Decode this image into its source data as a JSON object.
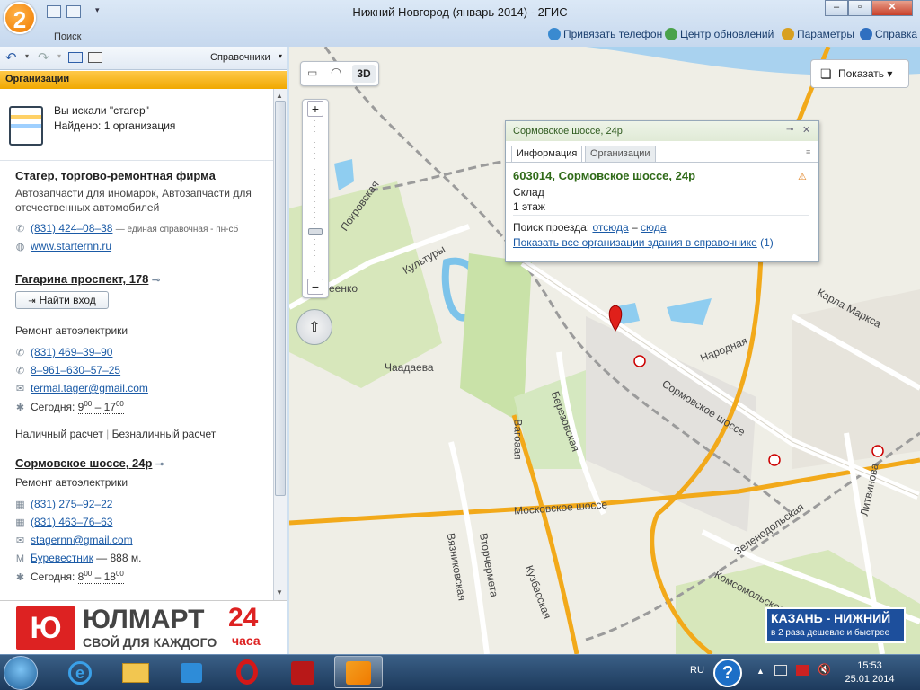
{
  "window": {
    "title": "Нижний Новгород (январь 2014) - 2ГИС",
    "min": "–",
    "max": "▫",
    "close": "✕",
    "logo": "2"
  },
  "ribbon": {
    "search_label": "Поиск",
    "links": [
      "Привязать телефон",
      "Центр обновлений",
      "Параметры",
      "Справка"
    ]
  },
  "left_toolbar": {
    "directories": "Справочники"
  },
  "orgs_header": "Организации",
  "search_summary": {
    "query": "Вы искали \"стагер\"",
    "found": "Найдено: 1 организация"
  },
  "company": {
    "name": "Стагер, торгово-ремонтная фирма",
    "categories_1": "Автозапчасти для иномарок, Автозапчасти для",
    "categories_2": "отечественных автомобилей",
    "phone": "(831) 424–08–38",
    "phone_note": "— единая справочная - пн-сб",
    "website": "www.starternn.ru"
  },
  "branch1": {
    "address": "Гагарина проспект, 178",
    "find_entrance": "Найти вход",
    "category": "Ремонт автоэлектрики",
    "phone1": "(831) 469–39–90",
    "phone2": "8–961–630–57–25",
    "email": "termal.tager@gmail.com",
    "hours_label": "Сегодня:",
    "hours_from": "9",
    "hours_from_min": "00",
    "hours_to": "17",
    "hours_to_min": "00",
    "payment_cash": "Наличный расчет",
    "payment_sep": "|",
    "payment_card": "Безналичный расчет"
  },
  "branch2": {
    "address": "Сормовское шоссе, 24р",
    "category": "Ремонт автоэлектрики",
    "fax1": "(831) 275–92–22",
    "fax2": "(831) 463–76–63",
    "email": "stagernn@gmail.com",
    "metro": "Буревестник",
    "metro_dist": "— 888 м.",
    "hours_label": "Сегодня:",
    "hours_from": "8",
    "hours_from_min": "00",
    "hours_to": "18",
    "hours_to_min": "00"
  },
  "map_tools": {
    "ruler": "▭",
    "measure": "◠",
    "mode3d": "3D",
    "zoom_in": "+",
    "zoom_out": "−",
    "zoom_level": 0.27,
    "show": "Показать"
  },
  "popup": {
    "title": "Сормовское шоссе, 24р",
    "tab_info": "Информация",
    "tab_orgs": "Организации",
    "address": "603014, Сормовское шоссе, 24р",
    "type": "Склад",
    "floors": "1 этаж",
    "route_label": "Поиск проезда:",
    "route_from": "отсюда",
    "route_dash": "–",
    "route_to": "сюда",
    "show_all": "Показать все организации здания в справочнике",
    "show_all_count": "(1)"
  },
  "map_labels": [
    "Покровская",
    "Культуры",
    "Чаадаева",
    "Сормовское шоссе",
    "Народная",
    "Карла Маркса",
    "Березовская",
    "Вагоаая",
    "Московское шоссе",
    "Вязниковская",
    "Вторчермета",
    "Кузбасская",
    "Зеленодольская",
    "Комсомольское ш.",
    "Литвинова",
    "еенко"
  ],
  "ads": {
    "left_brand": "ЮЛМАРТ",
    "left_slogan": "СВОЙ ДЛЯ КАЖДОГО",
    "left_24": "24",
    "left_hours": "часа",
    "right_title": "КАЗАНЬ - НИЖНИЙ",
    "right_sub": "в 2 раза дешевле и быстрее"
  },
  "taskbar": {
    "lang": "RU",
    "time": "15:53",
    "date": "25.01.2014"
  }
}
